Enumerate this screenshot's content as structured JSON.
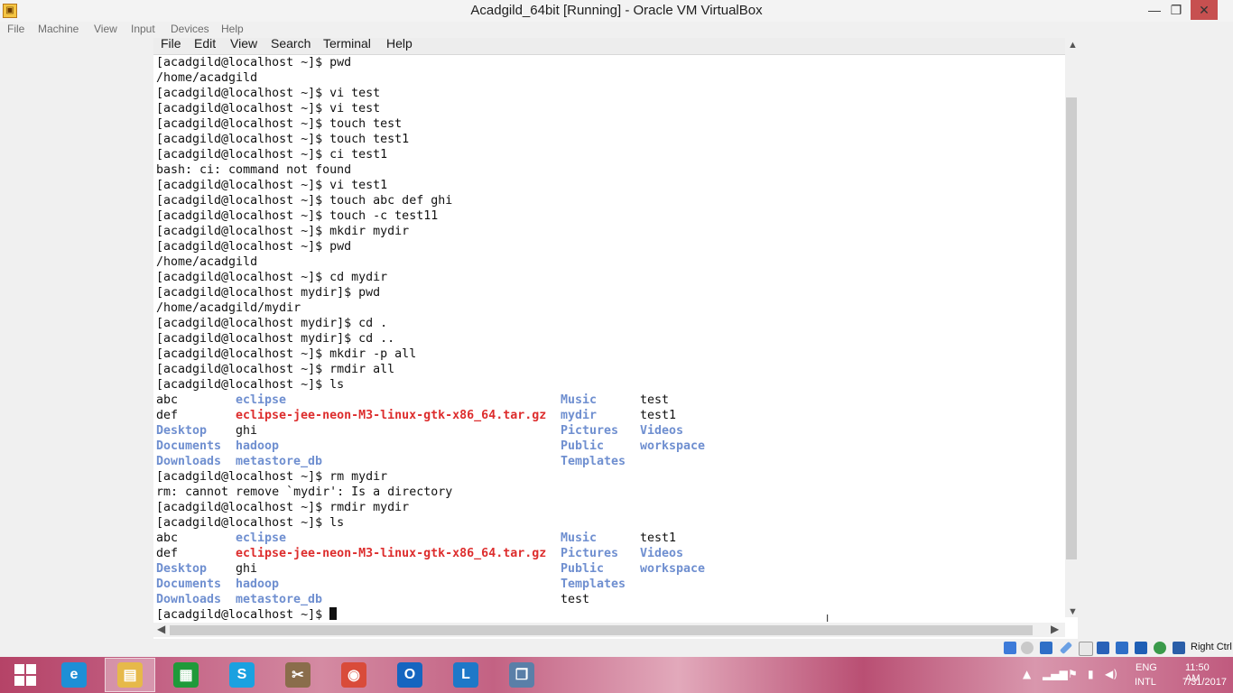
{
  "window": {
    "title": "Acadgild_64bit [Running] - Oracle VM VirtualBox",
    "minimize": "—",
    "restore": "❐",
    "close": "✕"
  },
  "vbox_menu": [
    "File",
    "Machine",
    "View",
    "Input",
    "Devices",
    "Help"
  ],
  "terminal_menu": [
    "File",
    "Edit",
    "View",
    "Search",
    "Terminal",
    "Help"
  ],
  "terminal": {
    "lines": [
      "[acadgild@localhost ~]$ pwd",
      "/home/acadgild",
      "[acadgild@localhost ~]$ vi test",
      "[acadgild@localhost ~]$ vi test",
      "[acadgild@localhost ~]$ touch test",
      "[acadgild@localhost ~]$ touch test1",
      "[acadgild@localhost ~]$ ci test1",
      "bash: ci: command not found",
      "[acadgild@localhost ~]$ vi test1",
      "[acadgild@localhost ~]$ touch abc def ghi",
      "[acadgild@localhost ~]$ touch -c test11",
      "[acadgild@localhost ~]$ mkdir mydir",
      "[acadgild@localhost ~]$ pwd",
      "/home/acadgild",
      "[acadgild@localhost ~]$ cd mydir",
      "[acadgild@localhost mydir]$ pwd",
      "/home/acadgild/mydir",
      "[acadgild@localhost mydir]$ cd .",
      "[acadgild@localhost mydir]$ cd ..",
      "[acadgild@localhost ~]$ mkdir -p all",
      "[acadgild@localhost ~]$ rmdir all",
      "[acadgild@localhost ~]$ ls"
    ],
    "ls1": [
      [
        {
          "t": "abc",
          "k": "f"
        },
        {
          "t": "eclipse",
          "k": "d"
        },
        {
          "t": "Music",
          "k": "d"
        },
        {
          "t": "test",
          "k": "f"
        }
      ],
      [
        {
          "t": "def",
          "k": "f"
        },
        {
          "t": "eclipse-jee-neon-M3-linux-gtk-x86_64.tar.gz",
          "k": "a"
        },
        {
          "t": "mydir",
          "k": "d"
        },
        {
          "t": "test1",
          "k": "f"
        }
      ],
      [
        {
          "t": "Desktop",
          "k": "d"
        },
        {
          "t": "ghi",
          "k": "f"
        },
        {
          "t": "Pictures",
          "k": "d"
        },
        {
          "t": "Videos",
          "k": "d"
        }
      ],
      [
        {
          "t": "Documents",
          "k": "d"
        },
        {
          "t": "hadoop",
          "k": "d"
        },
        {
          "t": "Public",
          "k": "d"
        },
        {
          "t": "workspace",
          "k": "d"
        }
      ],
      [
        {
          "t": "Downloads",
          "k": "d"
        },
        {
          "t": "metastore_db",
          "k": "d"
        },
        {
          "t": "Templates",
          "k": "d"
        },
        {
          "t": "",
          "k": "f"
        }
      ]
    ],
    "lines2": [
      "[acadgild@localhost ~]$ rm mydir",
      "rm: cannot remove `mydir': Is a directory",
      "[acadgild@localhost ~]$ rmdir mydir",
      "[acadgild@localhost ~]$ ls"
    ],
    "ls2": [
      [
        {
          "t": "abc",
          "k": "f"
        },
        {
          "t": "eclipse",
          "k": "d"
        },
        {
          "t": "Music",
          "k": "d"
        },
        {
          "t": "test1",
          "k": "f"
        }
      ],
      [
        {
          "t": "def",
          "k": "f"
        },
        {
          "t": "eclipse-jee-neon-M3-linux-gtk-x86_64.tar.gz",
          "k": "a"
        },
        {
          "t": "Pictures",
          "k": "d"
        },
        {
          "t": "Videos",
          "k": "d"
        }
      ],
      [
        {
          "t": "Desktop",
          "k": "d"
        },
        {
          "t": "ghi",
          "k": "f"
        },
        {
          "t": "Public",
          "k": "d"
        },
        {
          "t": "workspace",
          "k": "d"
        }
      ],
      [
        {
          "t": "Documents",
          "k": "d"
        },
        {
          "t": "hadoop",
          "k": "d"
        },
        {
          "t": "Templates",
          "k": "d"
        },
        {
          "t": "",
          "k": "f"
        }
      ],
      [
        {
          "t": "Downloads",
          "k": "d"
        },
        {
          "t": "metastore_db",
          "k": "d"
        },
        {
          "t": "test",
          "k": "f"
        },
        {
          "t": "",
          "k": "f"
        }
      ]
    ],
    "prompt": "[acadgild@localhost ~]$ "
  },
  "colors": {
    "directory": "#6f8fd0",
    "archive": "#dd2d2d",
    "close_button": "#c75050"
  },
  "status_bar": {
    "icons": [
      "hard-disk-icon",
      "optical-disk-icon",
      "network-icon",
      "usb-icon",
      "shared-folders-icon",
      "display-icon",
      "video-capture-icon",
      "cpu-icon",
      "mouse-integration-icon",
      "host-key-icon"
    ],
    "host_key": "Right Ctrl"
  },
  "taskbar": {
    "apps": [
      {
        "name": "internet-explorer",
        "glyph": "e",
        "color": "#1e8fd6"
      },
      {
        "name": "file-explorer",
        "glyph": "▤",
        "color": "#e6b94a"
      },
      {
        "name": "store",
        "glyph": "▦",
        "color": "#1f9a3a"
      },
      {
        "name": "skype",
        "glyph": "S",
        "color": "#1aa1e0"
      },
      {
        "name": "tools",
        "glyph": "✂",
        "color": "#8a6d4b"
      },
      {
        "name": "chrome",
        "glyph": "◉",
        "color": "#d94b3a"
      },
      {
        "name": "outlook",
        "glyph": "O",
        "color": "#1565c0"
      },
      {
        "name": "lync",
        "glyph": "L",
        "color": "#1e78c8"
      },
      {
        "name": "virtualbox",
        "glyph": "❒",
        "color": "#5a7fa8"
      }
    ],
    "language_1": "ENG",
    "language_2": "INTL",
    "time": "11:50 AM",
    "date": "7/31/2017"
  }
}
